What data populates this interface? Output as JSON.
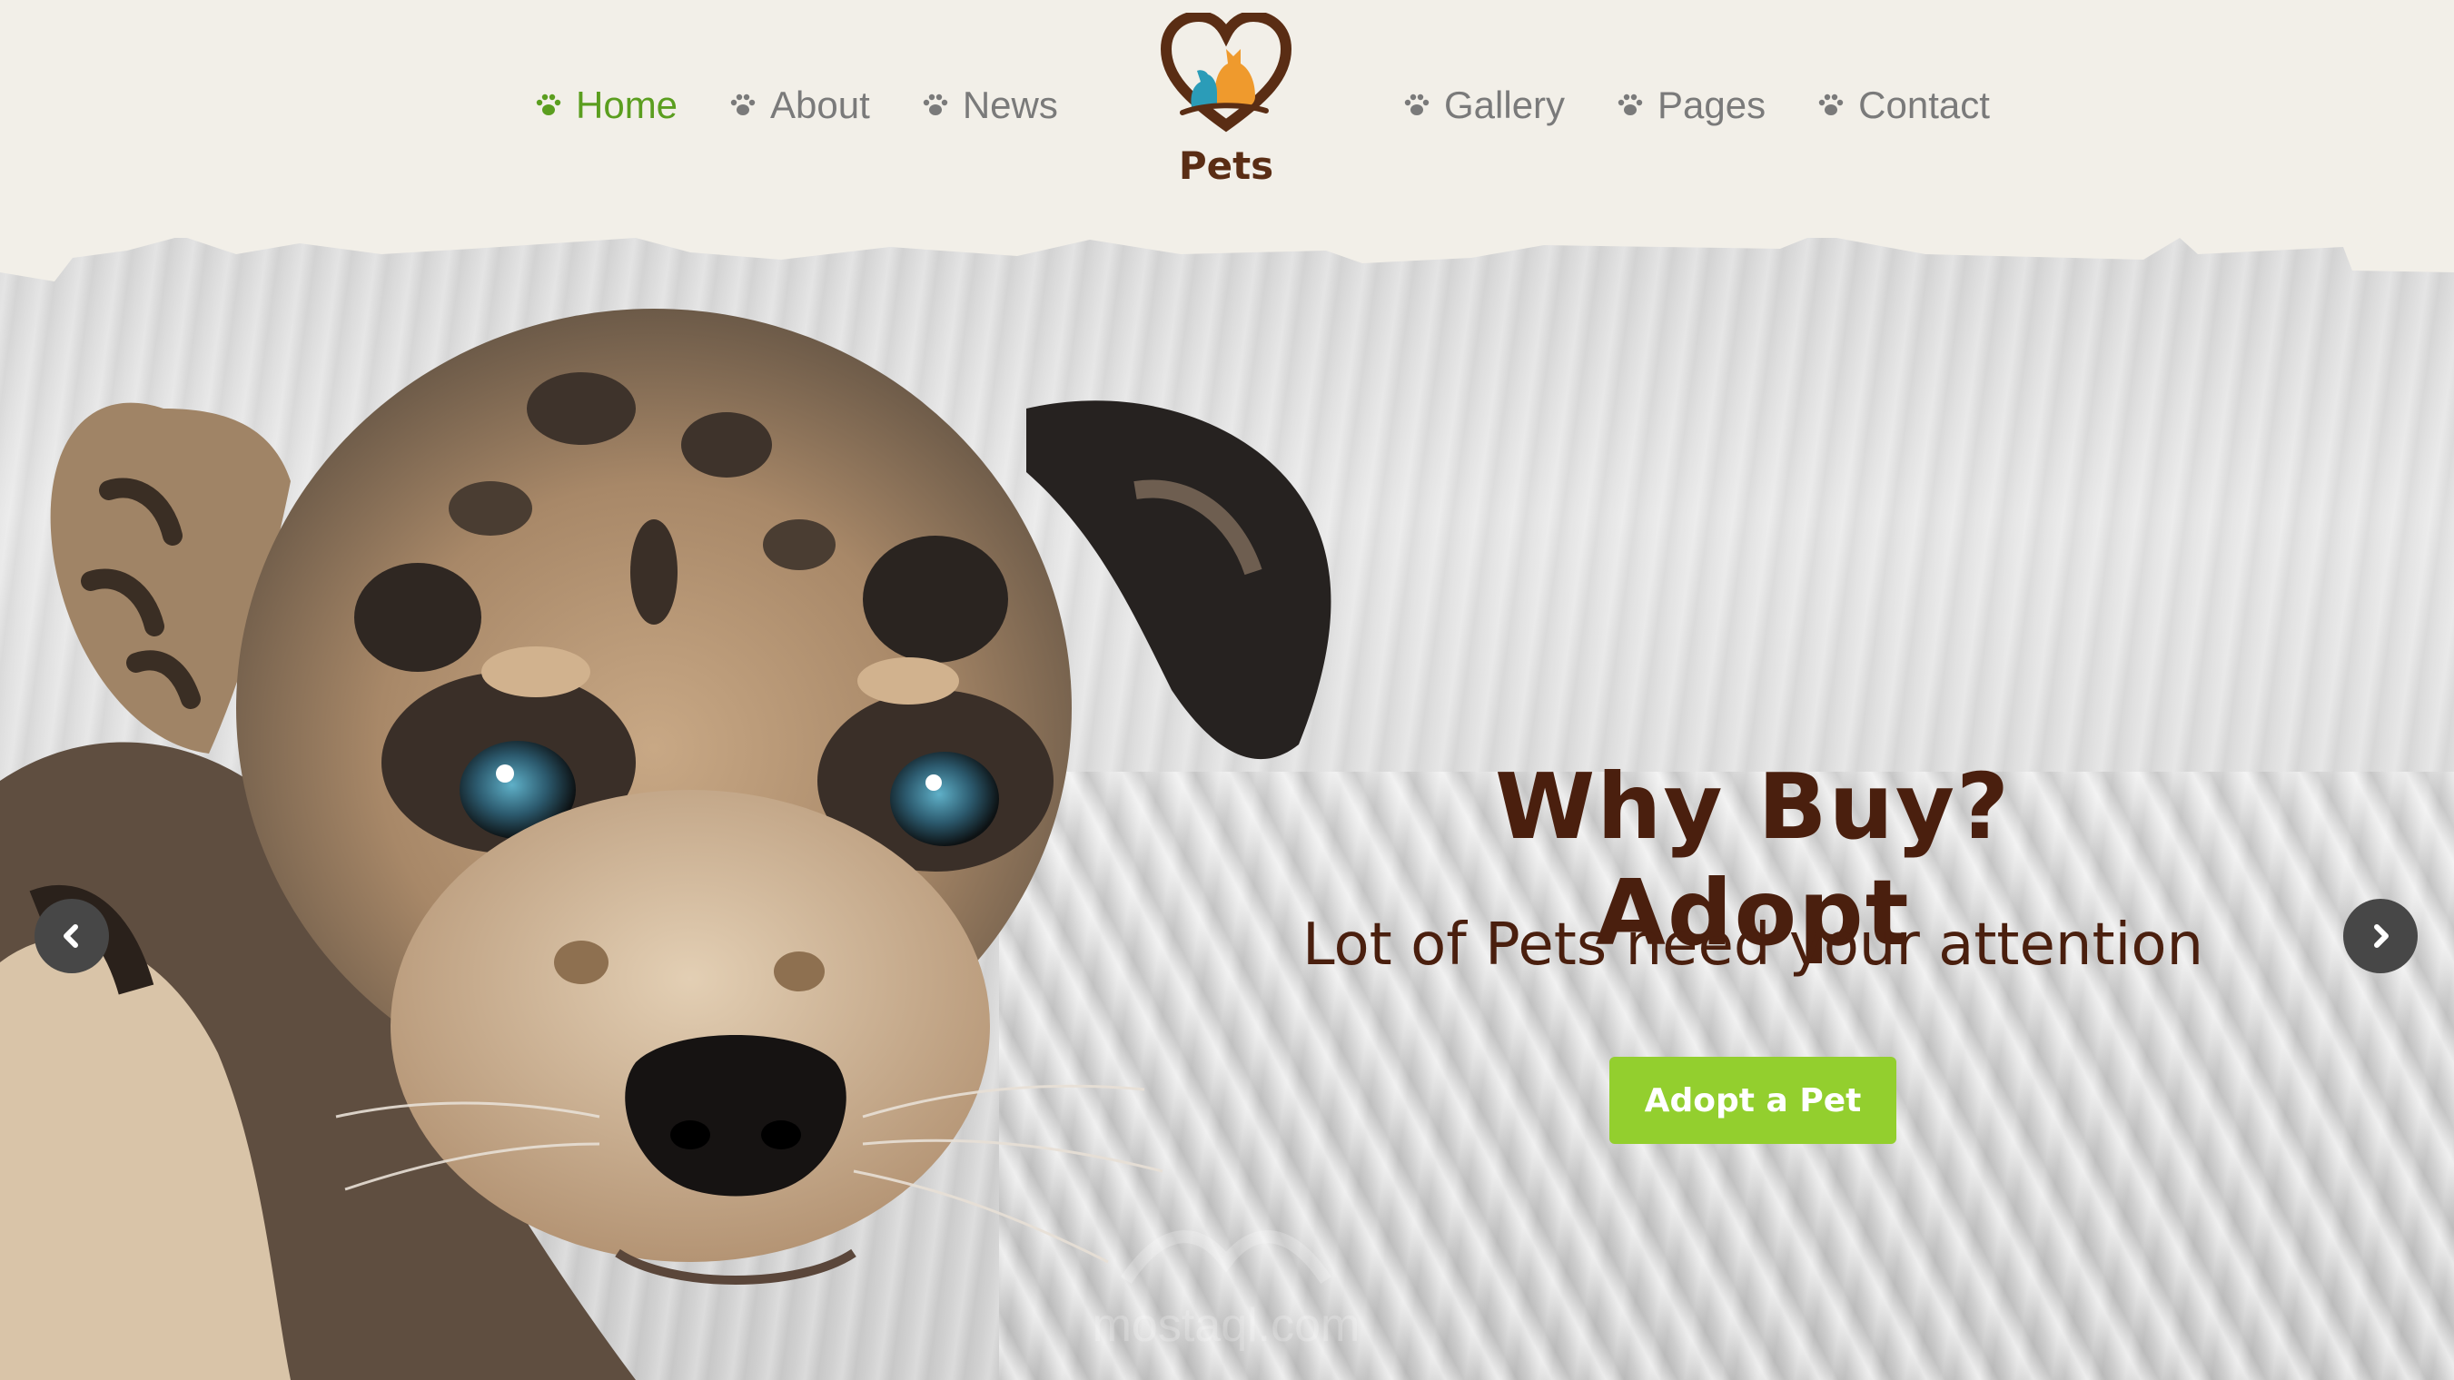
{
  "nav": {
    "left": [
      {
        "label": "Home",
        "active": true
      },
      {
        "label": "About",
        "active": false
      },
      {
        "label": "News",
        "active": false
      }
    ],
    "right": [
      {
        "label": "Gallery",
        "active": false
      },
      {
        "label": "Pages",
        "active": false
      },
      {
        "label": "Contact",
        "active": false
      }
    ],
    "icon": "paw-icon"
  },
  "logo": {
    "text": "Pets",
    "icon": "heart-pets-logo-icon"
  },
  "slide": {
    "title": "Why Buy? Adopt",
    "subtitle": "Lot of Pets need your attention",
    "button": "Adopt a Pet"
  },
  "carousel": {
    "prev_icon": "chevron-left-icon",
    "next_icon": "chevron-right-icon"
  },
  "watermark": {
    "text": "mostaql.com"
  },
  "colors": {
    "background": "#f2efe8",
    "nav_text": "#7a7a7a",
    "nav_active": "#5b9e1f",
    "heading": "#4a1f0e",
    "button": "#93cf2e",
    "arrow_bg": "#474747"
  }
}
